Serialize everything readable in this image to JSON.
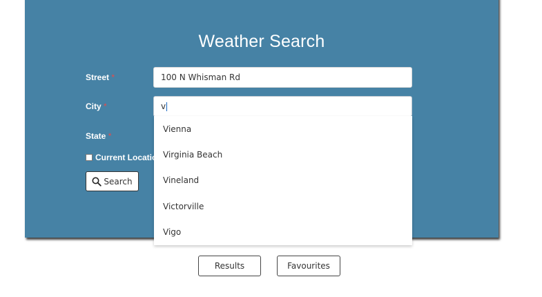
{
  "form": {
    "title": "Weather Search",
    "street_label": "Street",
    "street_value": "100 N Whisman Rd",
    "city_label": "City",
    "city_value": "v",
    "state_label": "State",
    "required_marker": "*",
    "current_location_label": "Current Location",
    "search_label": "Search"
  },
  "autocomplete": {
    "options": [
      "Vienna",
      "Virginia Beach",
      "Vineland",
      "Victorville",
      "Vigo"
    ]
  },
  "nav": {
    "results_label": "Results",
    "favourites_label": "Favourites"
  },
  "colors": {
    "card_background": "#4682a5",
    "required_marker": "#e84a4a",
    "caret": "#1565c0"
  },
  "icons": {
    "search": "magnifier-icon"
  }
}
